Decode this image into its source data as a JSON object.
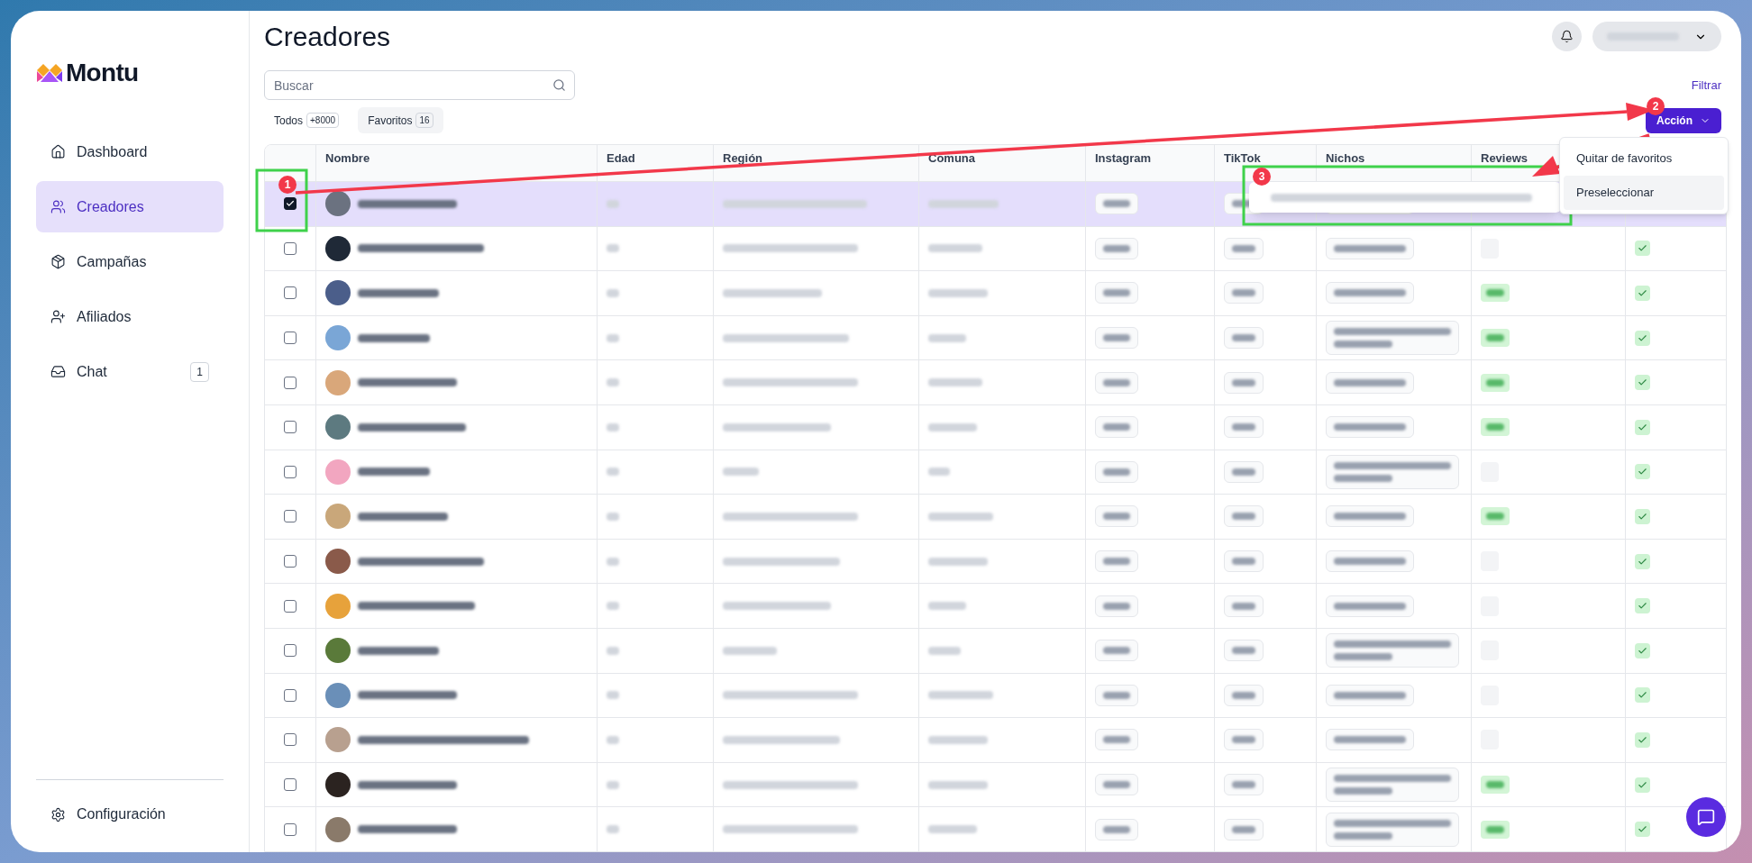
{
  "brand": {
    "name": "Montu"
  },
  "sidebar": {
    "items": [
      {
        "label": "Dashboard",
        "selected": false
      },
      {
        "label": "Creadores",
        "selected": true
      },
      {
        "label": "Campañas",
        "selected": false
      },
      {
        "label": "Afiliados",
        "selected": false
      },
      {
        "label": "Chat",
        "selected": false,
        "badge": "1"
      }
    ],
    "footer": {
      "label": "Configuración"
    }
  },
  "header": {
    "title": "Creadores"
  },
  "search": {
    "placeholder": "Buscar"
  },
  "filter_link": "Filtrar",
  "tabs": [
    {
      "label": "Todos",
      "count": "+8000",
      "selected": false
    },
    {
      "label": "Favoritos",
      "count": "16",
      "selected": true
    }
  ],
  "action_button": "Acción",
  "action_menu": [
    {
      "label": "Quitar de favoritos",
      "selected": false
    },
    {
      "label": "Preseleccionar",
      "selected": true
    }
  ],
  "table": {
    "columns": [
      "Nombre",
      "Edad",
      "Región",
      "Comuna",
      "Instagram",
      "TikTok",
      "Nichos",
      "Reviews"
    ],
    "rows": [
      {
        "selected": true,
        "verified": false
      },
      {
        "selected": false,
        "verified": true,
        "rated": false
      },
      {
        "selected": false,
        "verified": true,
        "rated": true
      },
      {
        "selected": false,
        "verified": true,
        "rated": true
      },
      {
        "selected": false,
        "verified": true,
        "rated": true
      },
      {
        "selected": false,
        "verified": true,
        "rated": true
      },
      {
        "selected": false,
        "verified": true,
        "rated": false
      },
      {
        "selected": false,
        "verified": true,
        "rated": true
      },
      {
        "selected": false,
        "verified": true,
        "rated": false
      },
      {
        "selected": false,
        "verified": true,
        "rated": false
      },
      {
        "selected": false,
        "verified": true,
        "rated": false
      },
      {
        "selected": false,
        "verified": true,
        "rated": false
      },
      {
        "selected": false,
        "verified": true,
        "rated": false
      },
      {
        "selected": false,
        "verified": true,
        "rated": true
      },
      {
        "selected": false,
        "verified": true,
        "rated": true
      }
    ]
  },
  "annotations": [
    {
      "label": "1"
    },
    {
      "label": "2"
    },
    {
      "label": "3"
    }
  ]
}
